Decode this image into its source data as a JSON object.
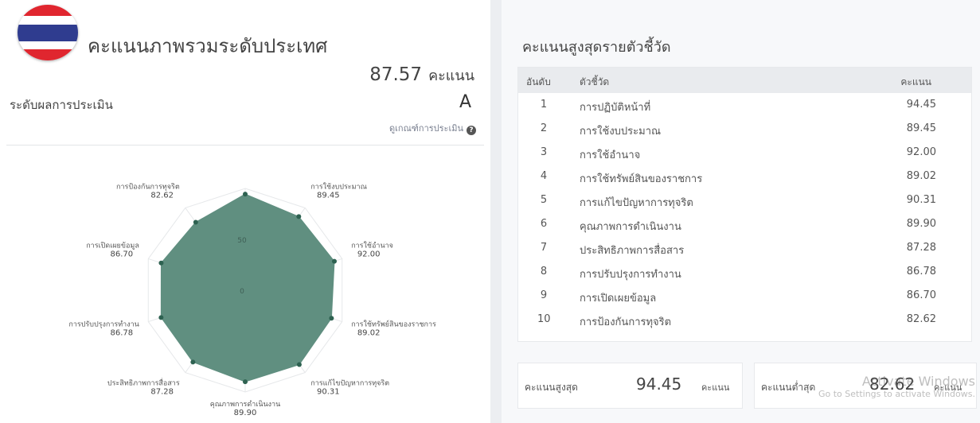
{
  "overall": {
    "title": "คะแนนภาพรวมระดับประเทศ",
    "score": "87.57",
    "score_unit": "คะแนน",
    "level_label": "ระดับผลการประเมิน",
    "level_value": "A",
    "criteria_link": "ดูเกณฑ์การประเมิน",
    "help_icon": "?"
  },
  "flag": {
    "icon": "thailand-flag-icon",
    "colors": [
      "#e0262f",
      "#ffffff",
      "#2f3c8f",
      "#ffffff",
      "#e0262f"
    ]
  },
  "colors": {
    "radar_fill": "#608f80",
    "radar_point": "#2e6251",
    "grid": "#e6e8ea"
  },
  "chart_data": {
    "type": "radar",
    "categories": [
      "การปฏิบัติหน้าที่",
      "การใช้งบประมาณ",
      "การใช้อำนาจ",
      "การใช้ทรัพย์สินของราชการ",
      "การแก้ไขปัญหาการทุจริต",
      "คุณภาพการดำเนินงาน",
      "ประสิทธิภาพการสื่อสาร",
      "การปรับปรุงการทำงาน",
      "การเปิดเผยข้อมูล",
      "การป้องกันการทุจริต"
    ],
    "values": [
      94.45,
      89.45,
      92.0,
      89.02,
      90.31,
      89.9,
      87.28,
      86.78,
      86.7,
      82.62
    ],
    "value_labels": [
      "94.45",
      "89.45",
      "92.00",
      "89.02",
      "90.31",
      "89.90",
      "87.28",
      "86.78",
      "86.70",
      "82.62"
    ],
    "range": [
      0,
      100
    ],
    "tick_labels": [
      "0",
      "50"
    ],
    "grid": true
  },
  "ranking": {
    "title": "คะแนนสูงสุดรายตัวชี้วัด",
    "headers": {
      "rank": "อันดับ",
      "indicator": "ตัวชี้วัด",
      "score": "คะแนน"
    },
    "rows": [
      {
        "rank": "1",
        "indicator": "การปฏิบัติหน้าที่",
        "score": "94.45"
      },
      {
        "rank": "2",
        "indicator": "การใช้งบประมาณ",
        "score": "89.45"
      },
      {
        "rank": "3",
        "indicator": "การใช้อำนาจ",
        "score": "92.00"
      },
      {
        "rank": "4",
        "indicator": "การใช้ทรัพย์สินของราชการ",
        "score": "89.02"
      },
      {
        "rank": "5",
        "indicator": "การแก้ไขปัญหาการทุจริต",
        "score": "90.31"
      },
      {
        "rank": "6",
        "indicator": "คุณภาพการดำเนินงาน",
        "score": "89.90"
      },
      {
        "rank": "7",
        "indicator": "ประสิทธิภาพการสื่อสาร",
        "score": "87.28"
      },
      {
        "rank": "8",
        "indicator": "การปรับปรุงการทำงาน",
        "score": "86.78"
      },
      {
        "rank": "9",
        "indicator": "การเปิดเผยข้อมูล",
        "score": "86.70"
      },
      {
        "rank": "10",
        "indicator": "การป้องกันการทุจริต",
        "score": "82.62"
      }
    ]
  },
  "summary": {
    "max_label": "คะแนนสูงสุด",
    "max_value": "94.45",
    "min_label": "คะแนนต่ำสุด",
    "min_value": "82.62",
    "unit": "คะแนน"
  },
  "watermark": {
    "line1": "Activate Windows",
    "line2": "Go to Settings to activate Windows."
  }
}
